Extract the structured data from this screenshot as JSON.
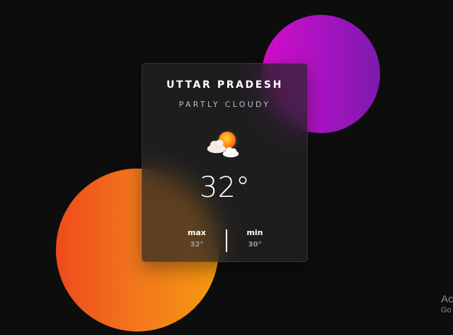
{
  "weather": {
    "location": "UTTAR PRADESH",
    "condition": "PARTLY CLOUDY",
    "icon": "partly-cloudy-icon",
    "temperature": "32°",
    "max_label": "max",
    "max_value": "32°",
    "min_label": "min",
    "min_value": "30°"
  },
  "background": {
    "purple_circle_colors": [
      "#d30cc8",
      "#7d1aad"
    ],
    "orange_circle_colors": [
      "#ef4a1c",
      "#f59a10"
    ],
    "page_color": "#0d0d0e"
  },
  "os_overlay": {
    "title": "Ac",
    "subtitle": "Go"
  }
}
